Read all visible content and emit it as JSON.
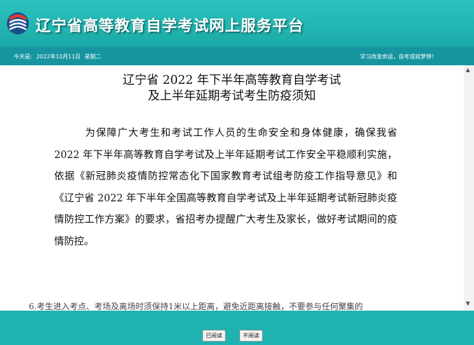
{
  "header": {
    "site_title": "辽宁省高等教育自学考试网上服务平台",
    "logo_icon": "exam-logo-icon"
  },
  "datebar": {
    "today_label": "今天是:",
    "date": "2022年10月11日",
    "weekday": "星期二",
    "slogan": "学习改变命运，自考成就梦想！"
  },
  "notice": {
    "title_line1": "辽宁省 2022 年下半年高等教育自学考试",
    "title_line2": "及上半年延期考试考生防疫须知",
    "paragraph": "为保障广大考生和考试工作人员的生命安全和身体健康，确保我省 2022 年下半年高等教育自学考试及上半年延期考试工作安全平稳顺利实施，依据《新冠肺炎疫情防控常态化下国家教育考试组考防疫工作指导意见》和《辽宁省 2022 年下半年全国高等教育自学考试及上半年延期考试新冠肺炎疫情防控工作方案》的要求，省招考办提醒广大考生及家长，做好考试期间的疫情防控。",
    "cut_line": "6.考生进入考点、考场及离场时须保持1米以上距离，避免近距离接触，不要参与任何聚集的"
  },
  "buttons": {
    "read": "已阅读",
    "not_read": "不阅读"
  },
  "colors": {
    "header_bg": "#22b5b1",
    "datebar_bg": "#1695a0",
    "page_bg": "#1fb2b0"
  }
}
